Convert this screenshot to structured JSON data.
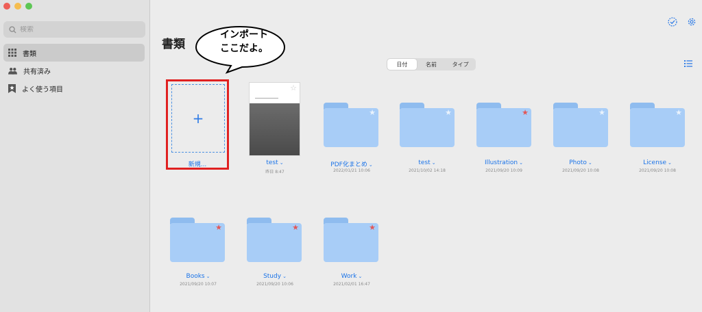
{
  "sidebar": {
    "search_placeholder": "検索",
    "items": [
      {
        "label": "書類",
        "icon": "grid-icon",
        "active": true
      },
      {
        "label": "共有済み",
        "icon": "people-icon",
        "active": false
      },
      {
        "label": "よく使う項目",
        "icon": "bookmark-star-icon",
        "active": false
      }
    ]
  },
  "main": {
    "title": "書類",
    "sort": [
      "日付",
      "名前",
      "タイプ"
    ],
    "sort_selected": "日付",
    "new_label": "新規...",
    "callout": "インポート\nここだよ。",
    "items": [
      {
        "name": "test",
        "date": "昨日 8:47",
        "kind": "document"
      },
      {
        "name": "PDF化まとめ",
        "date": "2022/01/21 10:06",
        "kind": "folder",
        "starred": false
      },
      {
        "name": "test",
        "date": "2021/10/02 14:18",
        "kind": "folder",
        "starred": false
      },
      {
        "name": "Illustration",
        "date": "2021/09/20 10:09",
        "kind": "folder",
        "starred": true
      },
      {
        "name": "Photo",
        "date": "2021/09/20 10:08",
        "kind": "folder",
        "starred": false
      },
      {
        "name": "License",
        "date": "2021/09/20 10:08",
        "kind": "folder",
        "starred": false
      },
      {
        "name": "Books",
        "date": "2021/09/20 10:07",
        "kind": "folder",
        "starred": true
      },
      {
        "name": "Study",
        "date": "2021/09/20 10:06",
        "kind": "folder",
        "starred": true
      },
      {
        "name": "Work",
        "date": "2021/02/01 16:47",
        "kind": "folder",
        "starred": true
      }
    ]
  },
  "colors": {
    "accent": "#1a73e8",
    "folder": "#a8cdf7",
    "star_active": "#e25757",
    "highlight": "#e02020"
  }
}
